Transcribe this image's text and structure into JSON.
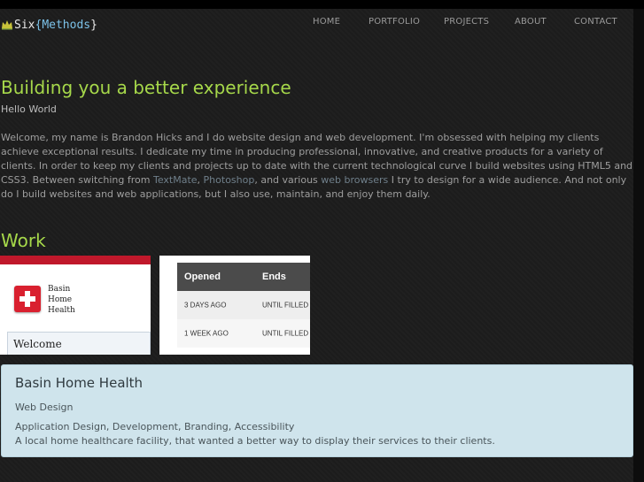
{
  "logo": {
    "icon": "crown-icon",
    "prefix": "Six",
    "brace_open": "{",
    "accent": "Methods",
    "brace_close": "}"
  },
  "nav": {
    "items": [
      {
        "label": "HOME"
      },
      {
        "label": "PORTFOLIO"
      },
      {
        "label": "PROJECTS"
      },
      {
        "label": "ABOUT"
      },
      {
        "label": "CONTACT"
      }
    ]
  },
  "hero": {
    "title": "Building you a better experience",
    "subtitle": "Hello World",
    "intro": {
      "p1": "Welcome, my name is Brandon Hicks and I do website design and web development. I'm obsessed with helping my clients achieve exceptional results. I dedicate my time in producing professional, innovative, and creative products for a variety of clients. In order to keep my clients and projects up to date with the current technological curve I build websites using HTML5 and CSS3. Between switching from ",
      "link1": "TextMate",
      "sep1": ", ",
      "link2": "Photoshop",
      "sep2": ", and various ",
      "link3": "web browsers",
      "p2": " I try to design for a wide audience. And not only do I build websites and web applications, but I also use, maintain, and enjoy them daily."
    }
  },
  "work": {
    "heading": "Work",
    "thumb1": {
      "brand_lines": [
        "Basin",
        "Home",
        "Health"
      ],
      "welcome": "Welcome"
    },
    "thumb2": {
      "headers": [
        "Opened",
        "Ends"
      ],
      "rows": [
        [
          "3 DAYS AGO",
          "UNTIL FILLED"
        ],
        [
          "1 WEEK AGO",
          "UNTIL FILLED"
        ]
      ]
    },
    "featured": {
      "title": "Basin Home Health",
      "category": "Web Design",
      "tags": "Application Design, Development, Branding, Accessibility",
      "description": "A local home healthcare facility, that wanted a better way to display their services to their clients."
    }
  },
  "colors": {
    "accent_green": "#a6d84a",
    "logo_blue": "#7cc2e8",
    "brand_red": "#c0182b",
    "panel_bg": "#cfe4ec"
  }
}
